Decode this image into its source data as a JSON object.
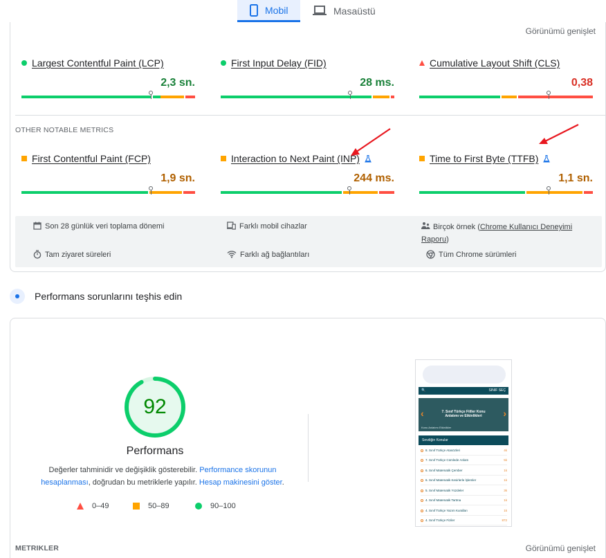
{
  "tabs": [
    {
      "label": "Mobil",
      "icon": "smartphone-icon",
      "active": true
    },
    {
      "label": "Masaüstü",
      "icon": "laptop-icon",
      "active": false
    }
  ],
  "field_data": {
    "expand_label": "Görünümü genişlet",
    "core": [
      {
        "label": "Largest Contentful Paint (LCP)",
        "value": "2,3 sn.",
        "status": "good",
        "marker": 0.75
      },
      {
        "label": "First Input Delay (FID)",
        "value": "28 ms.",
        "status": "good",
        "marker": 0.74
      },
      {
        "label": "Cumulative Layout Shift (CLS)",
        "value": "0,38",
        "status": "poor",
        "marker": 0.75
      }
    ],
    "other_title": "OTHER NOTABLE METRICS",
    "other": [
      {
        "label": "First Contentful Paint (FCP)",
        "value": "1,9 sn.",
        "status": "average",
        "experimental": false,
        "marker": 0.74
      },
      {
        "label": "Interaction to Next Paint (INP)",
        "value": "244 ms.",
        "status": "average",
        "experimental": true,
        "marker": 0.73
      },
      {
        "label": "Time to First Byte (TTFB)",
        "value": "1,1 sn.",
        "status": "average",
        "experimental": true,
        "marker": 0.74
      }
    ],
    "info": {
      "period": "Son 28 günlük veri toplama dönemi",
      "devices": "Farklı mobil cihazlar",
      "samples_prefix": "Birçok örnek (",
      "samples_link": "Chrome Kullanıcı Deneyimi Raporu",
      "samples_suffix": ")",
      "durations": "Tam ziyaret süreleri",
      "networks": "Farklı ağ bağlantıları",
      "chrome": "Tüm Chrome sürümleri"
    }
  },
  "diagnose": {
    "title": "Performans sorunlarını teşhis edin"
  },
  "lab": {
    "score": "92",
    "score_fraction": 0.92,
    "title": "Performans",
    "desc_part1": "Değerler tahminidir ve değişiklik gösterebilir. ",
    "desc_link1": "Performance skorunun hesaplanması",
    "desc_part2": ", doğrudan bu metriklerle yapılır. ",
    "desc_link2": "Hesap makinesini göster",
    "desc_part3": ".",
    "legend": [
      "0–49",
      "50–89",
      "90–100"
    ],
    "metrics_title": "METRIKLER",
    "expand_label": "Görünümü genişlet"
  },
  "thumbnail": {
    "nav_label": "SINIF SEÇ",
    "hero_title": "7. Sınıf Türkçe Fiiller Konu Anlatımı ve Etkinlikleri",
    "hero_sub": "Konu Anlatımı Etkinlikler",
    "band": "Sevdiğin Konular",
    "rows": [
      {
        "label": "8. Sınıf Türkçe Atasözleri",
        "count": "4k"
      },
      {
        "label": "7. Sınıf Türkçe Cümlede Anlam",
        "count": "5k"
      },
      {
        "label": "6. Sınıf Matematik Çember",
        "count": "1k"
      },
      {
        "label": "6. Sınıf Matematik Kesirlerle İşlemler",
        "count": "1k"
      },
      {
        "label": "5. Sınıf Matematik Yüzdeler",
        "count": "3k"
      },
      {
        "label": "4. Sınıf Matematik Tartma",
        "count": "1k"
      },
      {
        "label": "4. Sınıf Türkçe Yazım Kuralları",
        "count": "1k"
      },
      {
        "label": "4. Sınıf Türkçe Fiziler",
        "count": "872"
      }
    ]
  },
  "colors": {
    "good": "#0cce6b",
    "average": "#ffa400",
    "poor": "#ff4e42",
    "good_text": "#188038",
    "average_text": "#b06000",
    "poor_text": "#d93025",
    "accent": "#1a73e8"
  }
}
